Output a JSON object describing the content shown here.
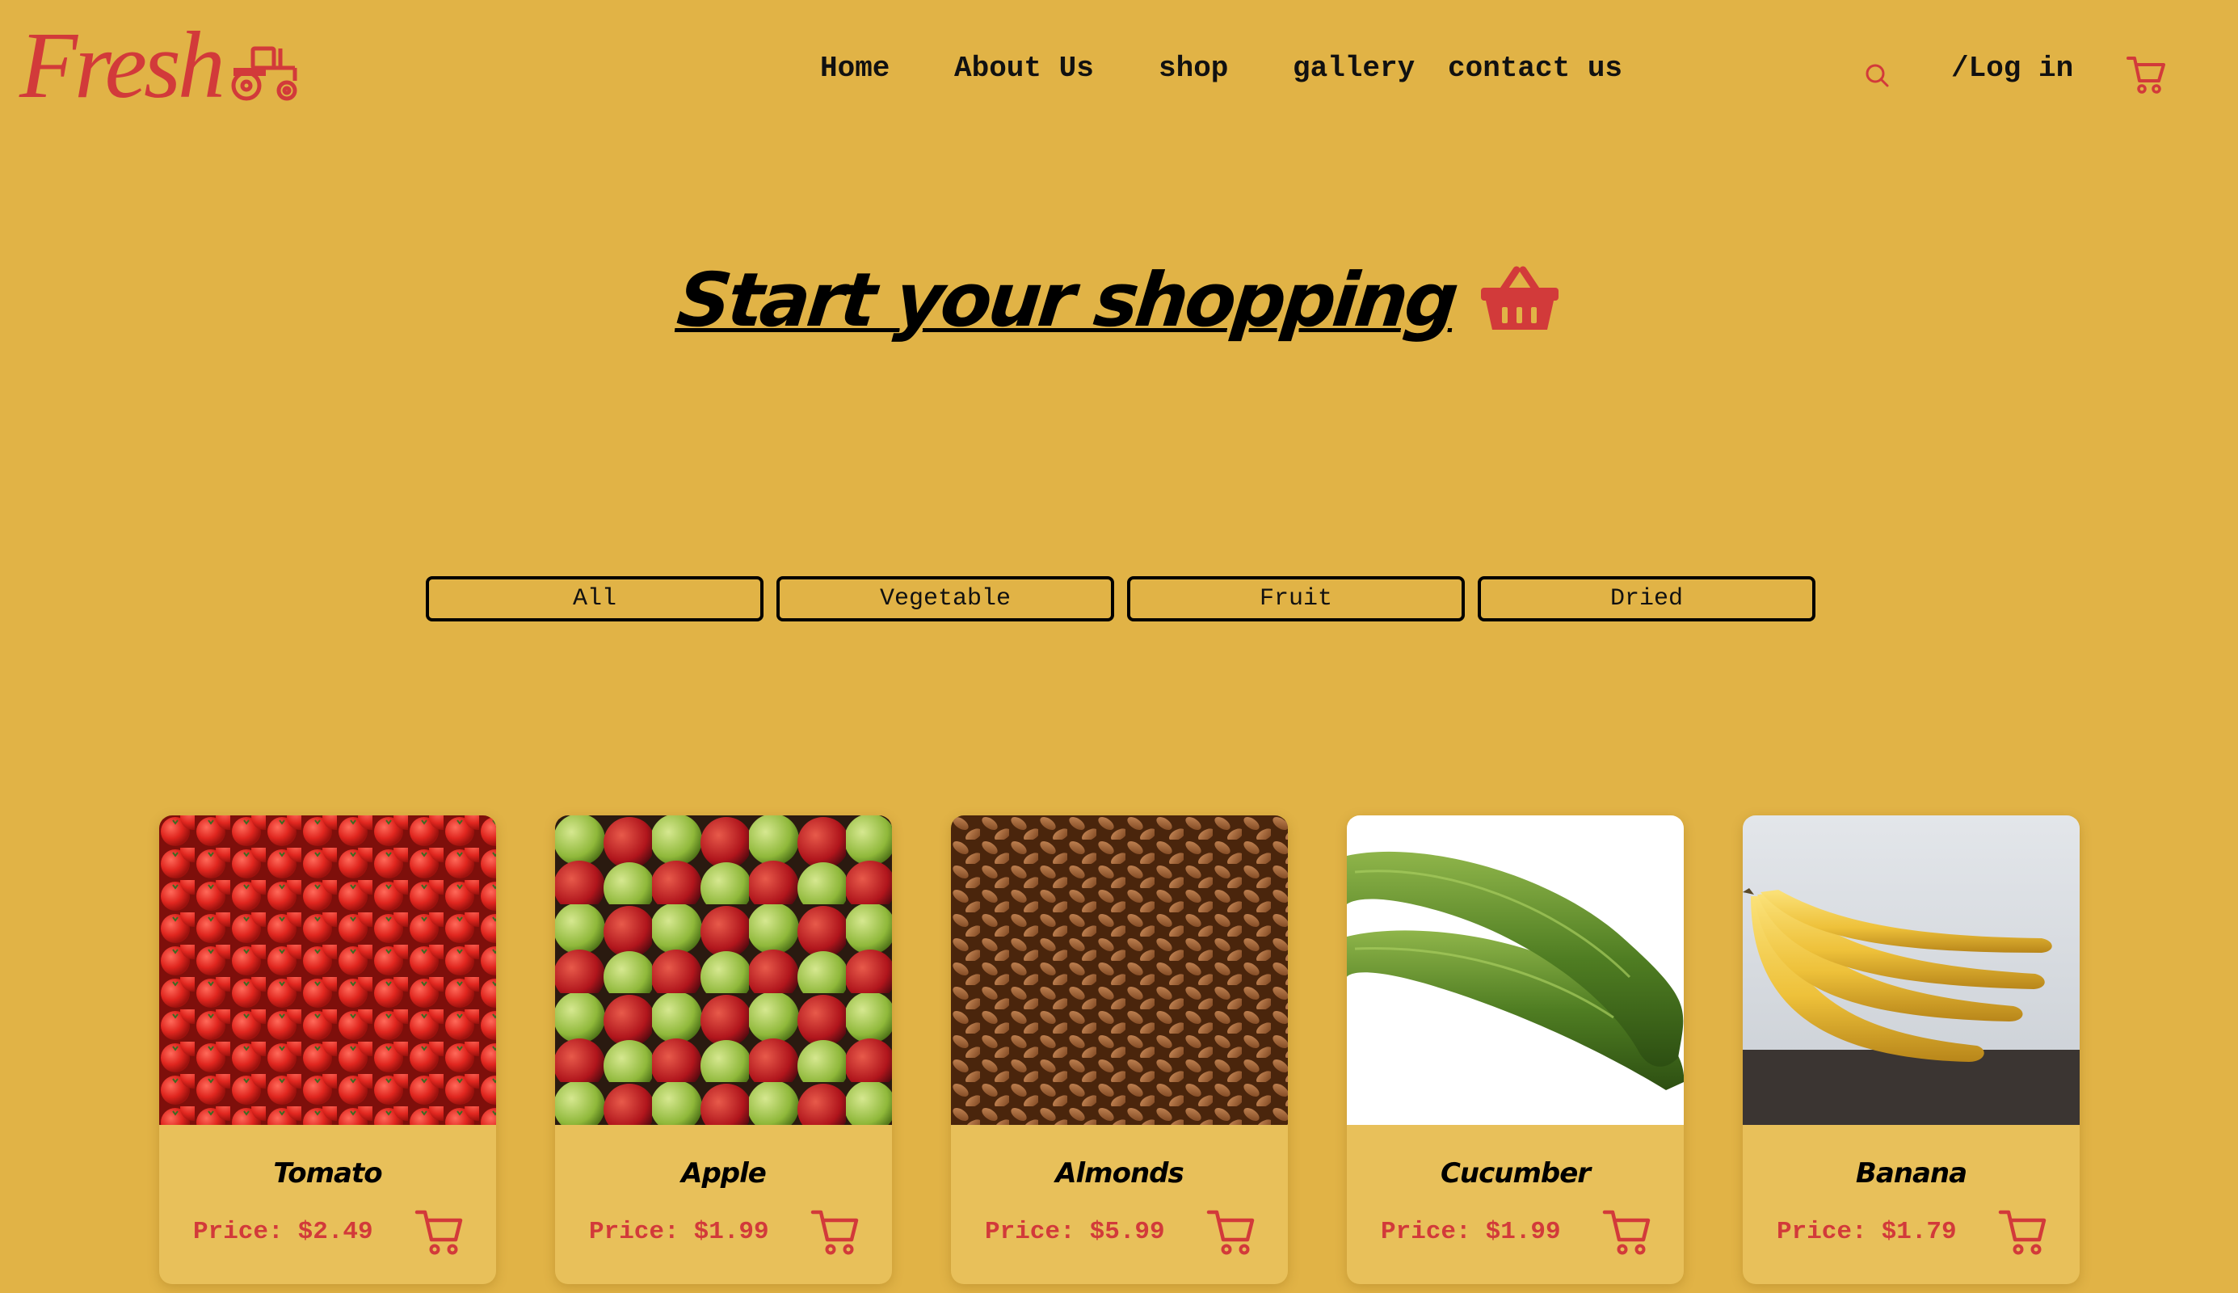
{
  "brand": {
    "logo_text": "Fresh",
    "logo_icon": "tractor-icon",
    "accent_color": "#d23a3a",
    "background_color": "#e1b346"
  },
  "nav": {
    "items": [
      {
        "label": "Home"
      },
      {
        "label": "About Us"
      },
      {
        "label": "shop"
      },
      {
        "label": "gallery"
      },
      {
        "label": "contact us"
      }
    ],
    "search_icon": "search-icon",
    "login_label": "/Log in",
    "cart_icon": "cart-icon"
  },
  "hero": {
    "title": "Start your shopping",
    "icon": "basket-icon"
  },
  "filters": [
    {
      "label": "All"
    },
    {
      "label": "Vegetable"
    },
    {
      "label": "Fruit"
    },
    {
      "label": "Dried"
    }
  ],
  "products": [
    {
      "name": "Tomato",
      "price_label": "Price:",
      "price": "$2.49",
      "image": "tomatoes-photo"
    },
    {
      "name": "Apple",
      "price_label": "Price:",
      "price": "$1.99",
      "image": "apples-photo"
    },
    {
      "name": "Almonds",
      "price_label": "Price:",
      "price": "$5.99",
      "image": "almonds-photo"
    },
    {
      "name": "Cucumber",
      "price_label": "Price:",
      "price": "$1.99",
      "image": "cucumbers-photo"
    },
    {
      "name": "Banana",
      "price_label": "Price:",
      "price": "$1.79",
      "image": "bananas-photo"
    }
  ]
}
